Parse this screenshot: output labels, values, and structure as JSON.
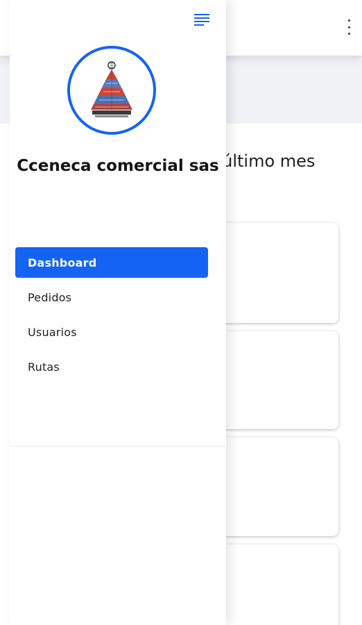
{
  "header": {
    "more_icon": "more-vertical-icon"
  },
  "main": {
    "section_title": "s último mes"
  },
  "drawer": {
    "menu_icon": "menu-icon",
    "logo_icon": "company-logo-pyramid",
    "company_name": "Cceneca comercial sas",
    "nav_items": [
      {
        "label": "Dashboard",
        "active": true
      },
      {
        "label": "Pedidos",
        "active": false
      },
      {
        "label": "Usuarios",
        "active": false
      },
      {
        "label": "Rutas",
        "active": false
      }
    ]
  },
  "colors": {
    "accent": "#1463f3",
    "background": "#f1f2f6",
    "surface": "#ffffff"
  }
}
